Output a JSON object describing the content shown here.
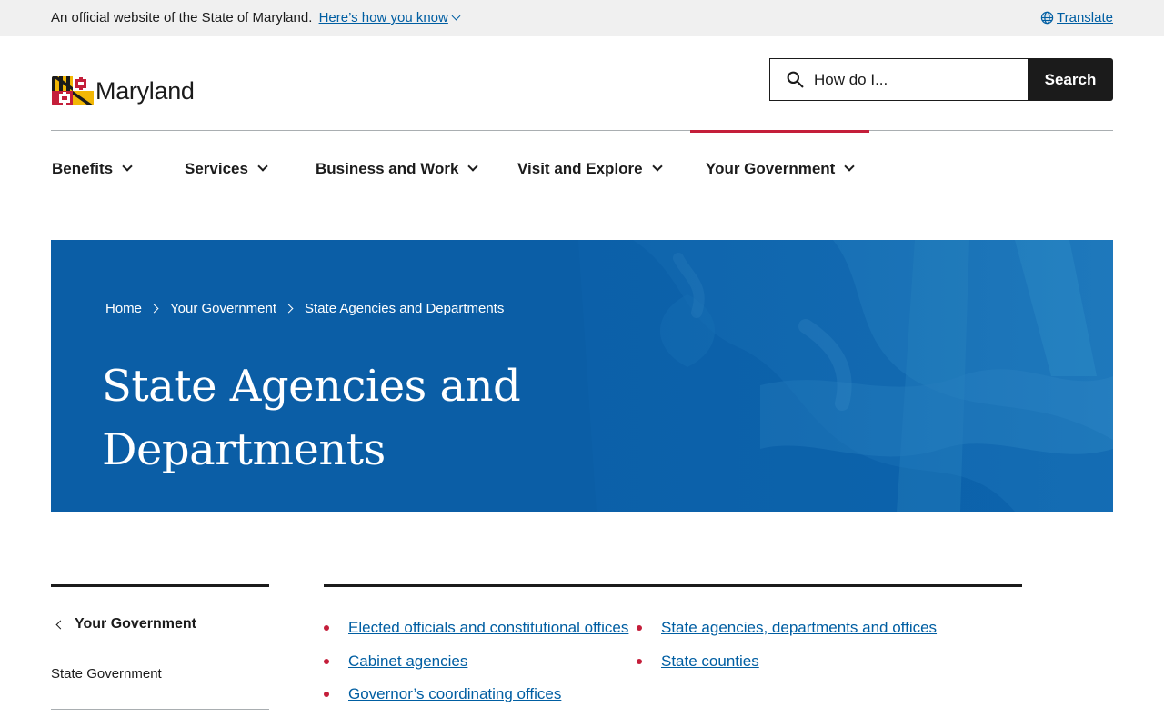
{
  "banner": {
    "text": "An official website of the State of Maryland.",
    "link": "Here’s how you know",
    "translate": "Translate"
  },
  "header": {
    "logo_text": "Maryland",
    "search_placeholder": "How do I...",
    "search_button": "Search"
  },
  "nav": {
    "items": [
      {
        "label": "Benefits"
      },
      {
        "label": "Services"
      },
      {
        "label": "Business and Work"
      },
      {
        "label": "Visit and Explore"
      },
      {
        "label": "Your Government"
      }
    ],
    "active": "Your Government"
  },
  "hero": {
    "breadcrumb": [
      "Home",
      "Your Government",
      "State Agencies and Departments"
    ],
    "title": "State Agencies and Departments"
  },
  "sidenav": {
    "back_label": "Your Government",
    "items": [
      "State Government"
    ]
  },
  "links": {
    "col1": [
      "Elected officials and constitutional offices",
      "Cabinet agencies",
      "Governor’s coordinating offices"
    ],
    "col2": [
      "State agencies, departments and offices",
      "State counties"
    ]
  },
  "colors": {
    "link": "#005ea2",
    "accent_red": "#c41e3a",
    "hero_blue": "#0b5ea6",
    "dark": "#1b1b1b"
  }
}
